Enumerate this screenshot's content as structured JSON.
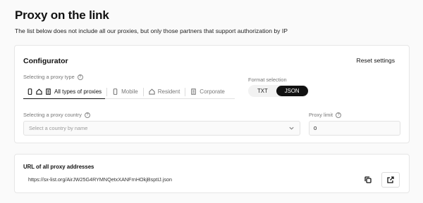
{
  "page": {
    "title": "Proxy on the link",
    "description": "The list below does not include all our proxies, but only those partners that support authorization by IP"
  },
  "configurator": {
    "title": "Configurator",
    "reset_label": "Reset settings",
    "proxy_type": {
      "label": "Selecting a proxy type",
      "options": [
        {
          "label": "All types of proxies",
          "icon": "all-types-icon",
          "active": true
        },
        {
          "label": "Mobile",
          "icon": "mobile-icon",
          "active": false
        },
        {
          "label": "Resident",
          "icon": "home-icon",
          "active": false
        },
        {
          "label": "Corporate",
          "icon": "building-icon",
          "active": false
        }
      ]
    },
    "format": {
      "label": "Format selection",
      "options": [
        "TXT",
        "JSON"
      ],
      "selected": "JSON"
    },
    "country": {
      "label": "Selecting a proxy country",
      "placeholder": "Select a country by name"
    },
    "limit": {
      "label": "Proxy limit",
      "value": "0"
    }
  },
  "url_card": {
    "label": "URL of all proxy addresses",
    "url": "https://sx-list.org/AirJW25G4RYMNQetxXANFrnHOkjBsptIJ.json"
  }
}
